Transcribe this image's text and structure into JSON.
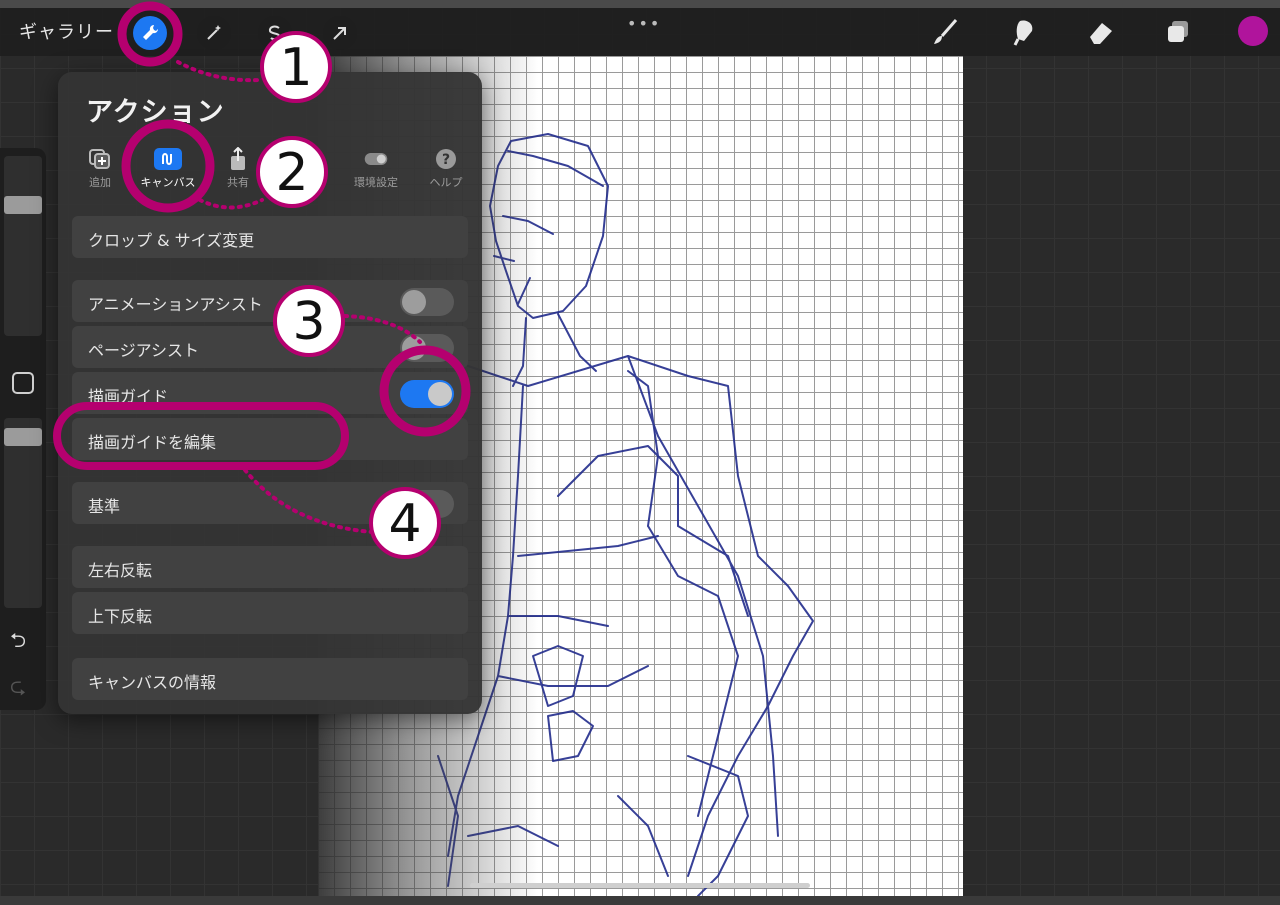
{
  "toolbar": {
    "gallery_label": "ギャラリー",
    "more_label": "•••",
    "color_accent": "#b0149c",
    "icons": [
      "wrench-icon",
      "magic-wand-icon",
      "selection-icon",
      "transform-arrow-icon",
      "brush-icon",
      "smudge-icon",
      "eraser-icon",
      "layers-icon"
    ]
  },
  "panel": {
    "title": "アクション",
    "tabs": [
      {
        "label": "追加",
        "icon": "add-icon"
      },
      {
        "label": "キャンバス",
        "icon": "canvas-icon",
        "selected": true
      },
      {
        "label": "共有",
        "icon": "share-icon"
      },
      {
        "label": "環境設定",
        "icon": "toggle-icon"
      },
      {
        "label": "ヘルプ",
        "icon": "help-icon"
      }
    ],
    "rows": {
      "crop": "クロップ & サイズ変更",
      "animation_assist": "アニメーションアシスト",
      "page_assist": "ページアシスト",
      "drawing_guide": "描画ガイド",
      "edit_drawing_guide": "描画ガイドを編集",
      "reference": "基準",
      "flip_horizontal": "左右反転",
      "flip_vertical": "上下反転",
      "canvas_info": "キャンバスの情報"
    },
    "toggles": {
      "animation_assist": false,
      "page_assist": false,
      "drawing_guide": true,
      "reference": false
    }
  },
  "annotations": {
    "badges": [
      "1",
      "2",
      "3",
      "4"
    ],
    "highlight_color": "#b5006f"
  },
  "colors": {
    "accent_blue": "#1d78f2",
    "panel_bg": "#343434",
    "sketch_stroke": "#1f2a8a"
  }
}
